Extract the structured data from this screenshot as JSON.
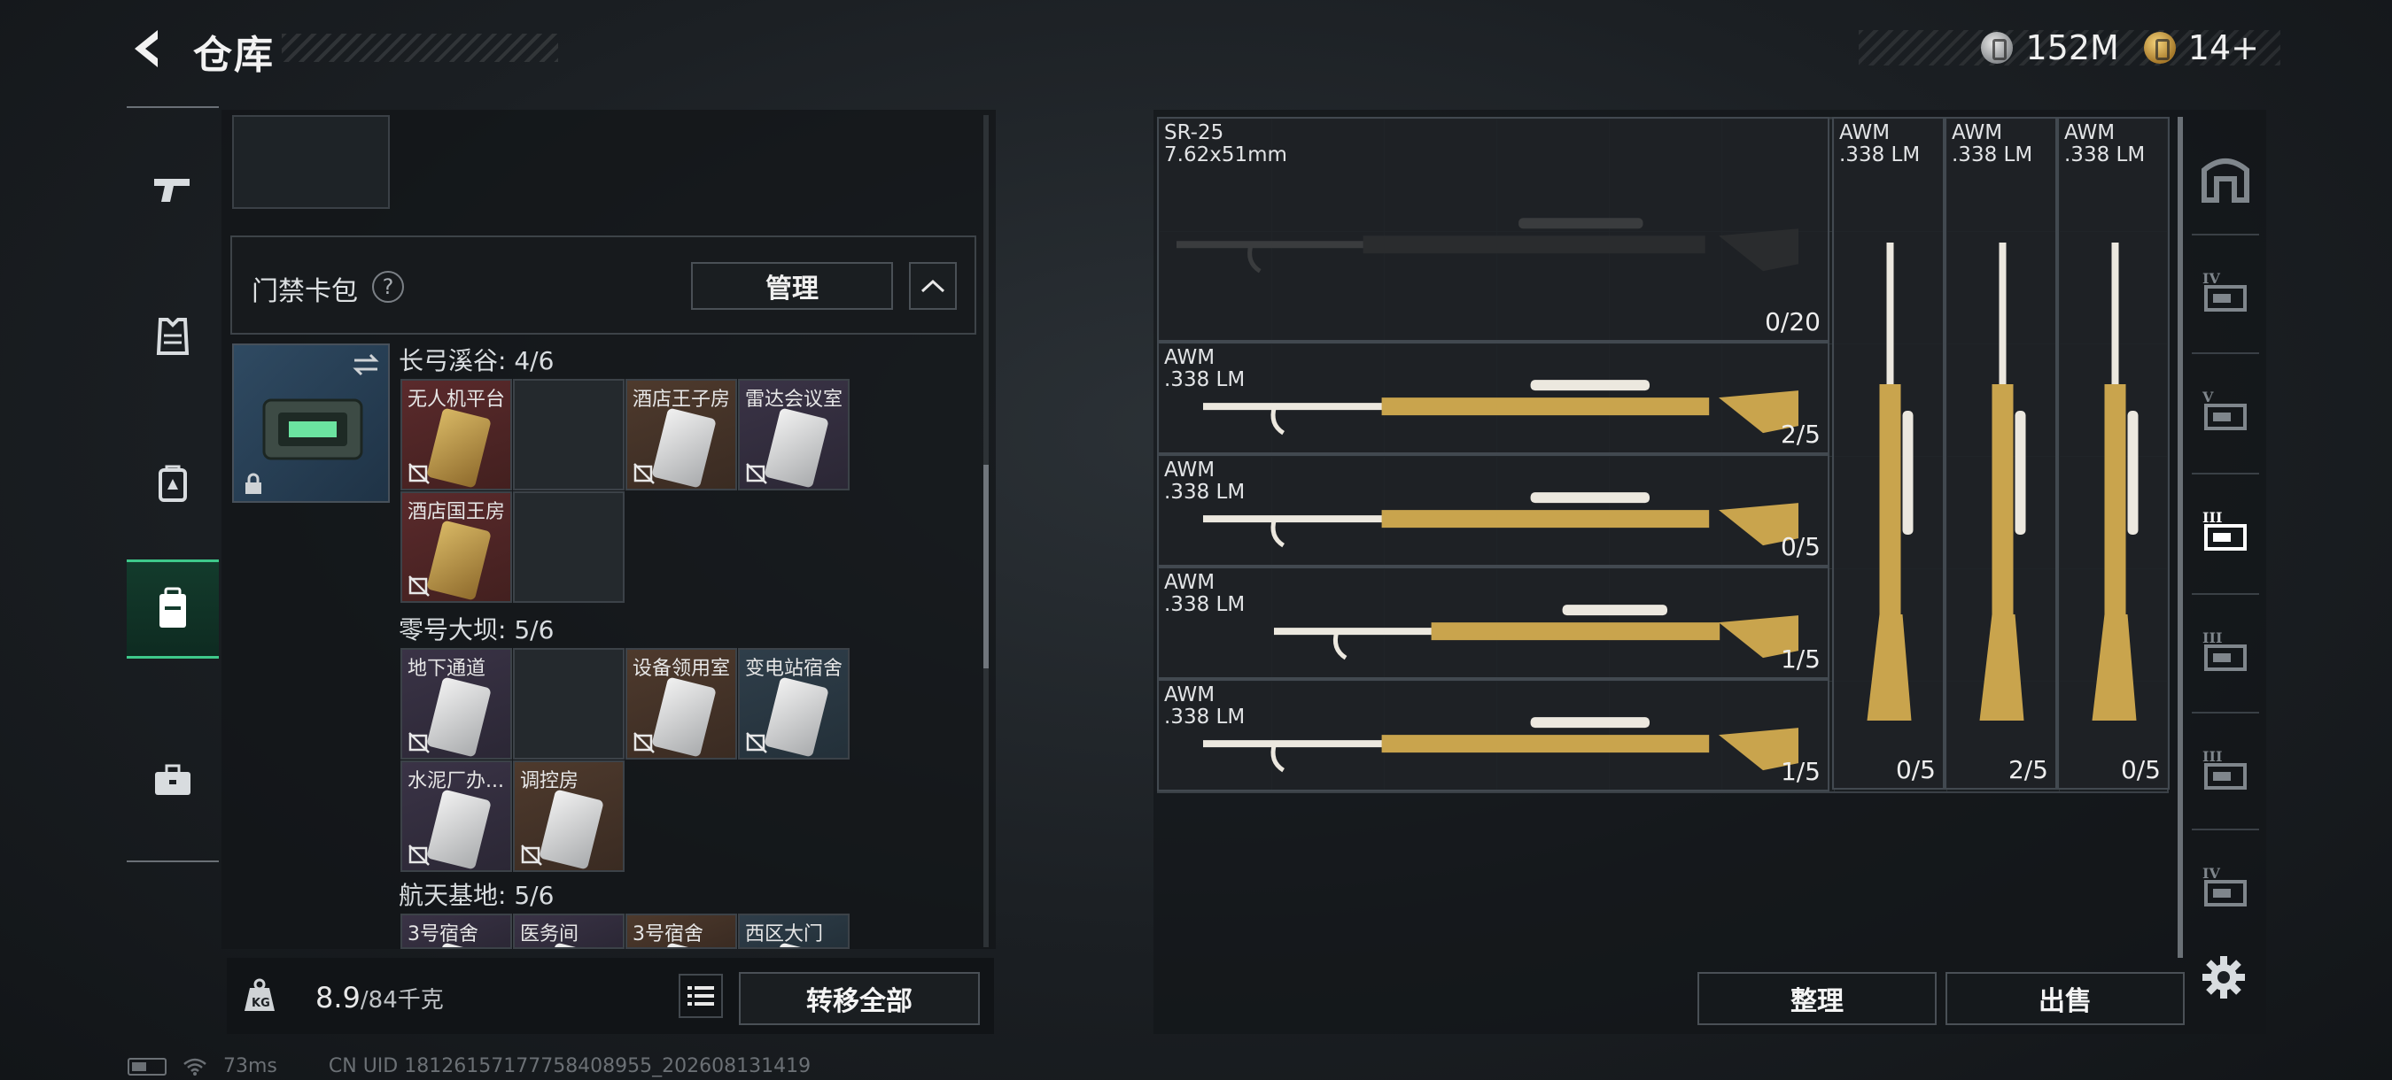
{
  "header": {
    "title": "仓库",
    "currency": [
      {
        "icon": "silver-coin-icon",
        "value": "152M"
      },
      {
        "icon": "gold-coin-icon",
        "value": "14+"
      }
    ]
  },
  "left_nav": [
    {
      "icon": "pistol-icon",
      "active": false
    },
    {
      "icon": "armor-vest-icon",
      "active": false
    },
    {
      "icon": "backpack-icon",
      "active": false
    },
    {
      "icon": "card-pack-icon",
      "active": true
    },
    {
      "icon": "briefcase-icon",
      "active": false
    }
  ],
  "card_pack": {
    "title": "门禁卡包",
    "help": "?",
    "manage_label": "管理"
  },
  "zones": [
    {
      "label": "长弓溪谷: 4/6",
      "slots": [
        {
          "label": "无人机平台",
          "color": "red",
          "card": "gold",
          "filled": true
        },
        {
          "label": "",
          "color": "empty",
          "card": "",
          "filled": false
        },
        {
          "label": "酒店王子房",
          "color": "brown",
          "card": "white",
          "filled": true
        },
        {
          "label": "雷达会议室",
          "color": "purple",
          "card": "white",
          "filled": true
        },
        {
          "label": "酒店国王房",
          "color": "red",
          "card": "gold",
          "filled": true
        },
        {
          "label": "",
          "color": "empty",
          "card": "",
          "filled": false
        }
      ]
    },
    {
      "label": "零号大坝: 5/6",
      "slots": [
        {
          "label": "地下通道",
          "color": "purple",
          "card": "white",
          "filled": true
        },
        {
          "label": "",
          "color": "empty",
          "card": "",
          "filled": false
        },
        {
          "label": "设备领用室",
          "color": "brown",
          "card": "white",
          "filled": true
        },
        {
          "label": "变电站宿舍",
          "color": "blue",
          "card": "white",
          "filled": true
        },
        {
          "label": "水泥厂办...",
          "color": "purple",
          "card": "white",
          "filled": true
        },
        {
          "label": "调控房",
          "color": "brown",
          "card": "white",
          "filled": true
        }
      ]
    },
    {
      "label": "航天基地: 5/6",
      "slots": [
        {
          "label": "3号宿舍",
          "color": "purple",
          "card": "white",
          "filled": true
        },
        {
          "label": "医务间",
          "color": "purple",
          "card": "white",
          "filled": true
        },
        {
          "label": "3号宿舍",
          "color": "brown",
          "card": "white",
          "filled": true
        },
        {
          "label": "西区大门",
          "color": "blue",
          "card": "white",
          "filled": true
        }
      ]
    }
  ],
  "footer_left": {
    "weight_current": "8.9",
    "weight_capacity": "/84千克",
    "transfer_all_label": "转移全部"
  },
  "status": {
    "ping": "73ms",
    "uid": "CN UID 1812615717775840895​5_202608131419"
  },
  "stash": {
    "weapons": [
      {
        "name": "SR-25",
        "caliber": "7.62x51mm",
        "count": "0/20",
        "style": "black"
      },
      {
        "name": "AWM",
        "caliber": ".338 LM",
        "count": "2/5",
        "style": "gold"
      },
      {
        "name": "AWM",
        "caliber": ".338 LM",
        "count": "0/5",
        "style": "gold"
      },
      {
        "name": "AWM",
        "caliber": ".338 LM",
        "count": "1/5",
        "style": "gold"
      },
      {
        "name": "AWM",
        "caliber": ".338 LM",
        "count": "1/5",
        "style": "gold"
      },
      {
        "name": "AWM",
        "caliber": ".338 LM",
        "count": "0/5",
        "style": "gold"
      },
      {
        "name": "AWM",
        "caliber": ".338 LM",
        "count": "2/5",
        "style": "gold"
      },
      {
        "name": "AWM",
        "caliber": ".338 LM",
        "count": "0/5",
        "style": "gold"
      }
    ],
    "tidy_label": "整理",
    "sell_label": "出售"
  },
  "right_nav": [
    {
      "icon": "safe-box-icon",
      "label": ""
    },
    {
      "icon": "tier-iv-container-icon",
      "label": "IV"
    },
    {
      "icon": "tier-v-container-icon",
      "label": "V"
    },
    {
      "icon": "tier-iii-rifle-icon",
      "label": "III"
    },
    {
      "icon": "tier-iii-gun-icon",
      "label": "III"
    },
    {
      "icon": "tier-iii-gun-alt-icon",
      "label": "III"
    },
    {
      "icon": "tier-iv-folder-icon",
      "label": "IV"
    }
  ],
  "colors": {
    "accent_green": "#3ec98b",
    "gold": "#c9a44d"
  }
}
